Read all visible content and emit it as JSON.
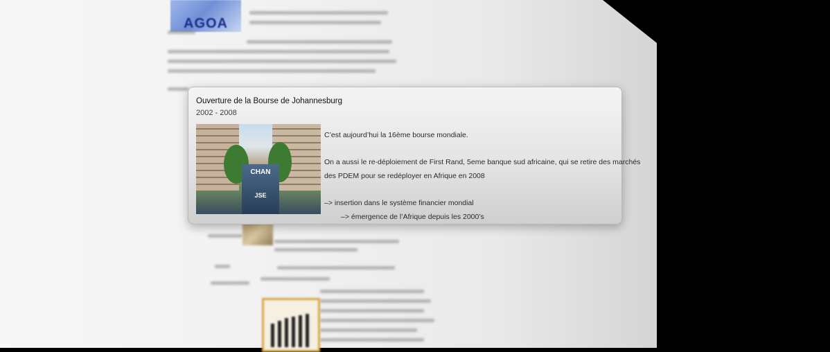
{
  "background_page": {
    "logo_text": "AGOA"
  },
  "popup": {
    "title": "Ouverture de la Bourse de Johannesburg",
    "date_range": "2002 - 2008",
    "image_sign_line1": "CHAN",
    "image_sign_line2": "JSE",
    "body": {
      "line1": "C’est aujourd’hui la 16ème bourse mondiale.",
      "line2": "On a aussi le re-déploiement de First Rand, 5eme banque sud africaine, qui se retire des marchés",
      "line3": "des PDEM pour se redéployer en Afrique en 2008",
      "line4": "–> insertion dans le système financier mondial",
      "line5": "–> émergence de l’Afrique depuis les 2000’s"
    }
  }
}
